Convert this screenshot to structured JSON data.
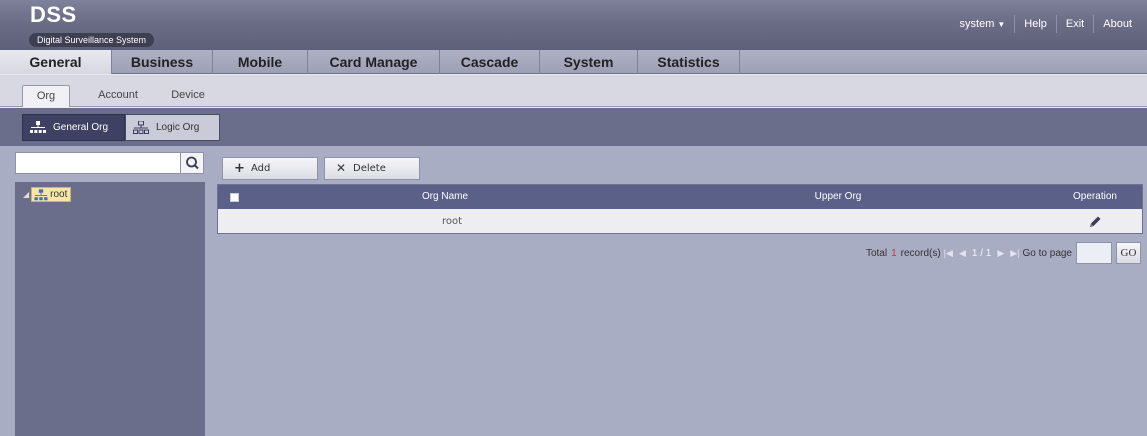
{
  "header": {
    "logo": "DSS",
    "subtitle": "Digital Surveillance System",
    "user_menu": "system",
    "help": "Help",
    "exit": "Exit",
    "about": "About"
  },
  "main_tabs": [
    {
      "label": "General",
      "active": true
    },
    {
      "label": "Business",
      "active": false
    },
    {
      "label": "Mobile",
      "active": false
    },
    {
      "label": "Card Manage",
      "active": false
    },
    {
      "label": "Cascade",
      "active": false
    },
    {
      "label": "System",
      "active": false
    },
    {
      "label": "Statistics",
      "active": false
    }
  ],
  "sub_tabs": [
    {
      "label": "Org",
      "active": true
    },
    {
      "label": "Account",
      "active": false
    },
    {
      "label": "Device",
      "active": false
    }
  ],
  "org_types": [
    {
      "label": "General Org",
      "active": true,
      "icon": "org-tree-icon"
    },
    {
      "label": "Logic Org",
      "active": false,
      "icon": "org-tree-icon"
    }
  ],
  "search": {
    "value": "",
    "placeholder": ""
  },
  "tree": {
    "root_label": "root"
  },
  "toolbar": {
    "add": "Add",
    "delete": "Delete"
  },
  "table": {
    "columns": [
      "Org Name",
      "Upper Org",
      "Operation"
    ],
    "rows": [
      {
        "org_name": "root",
        "upper_org": "",
        "operation_icon": "edit-pencil-icon"
      }
    ]
  },
  "pager": {
    "total_label": "Total",
    "total_count": "1",
    "records_label": "record(s)",
    "page_display": "1 / 1",
    "goto_label": "Go to page",
    "goto_value": "",
    "go_button": "GO"
  },
  "colors": {
    "header": "#6b6d86",
    "content_bg": "#a9adc4",
    "tree_bg": "#6b6e8a",
    "table_header": "#5a6088",
    "accent_red": "#cc3333"
  }
}
